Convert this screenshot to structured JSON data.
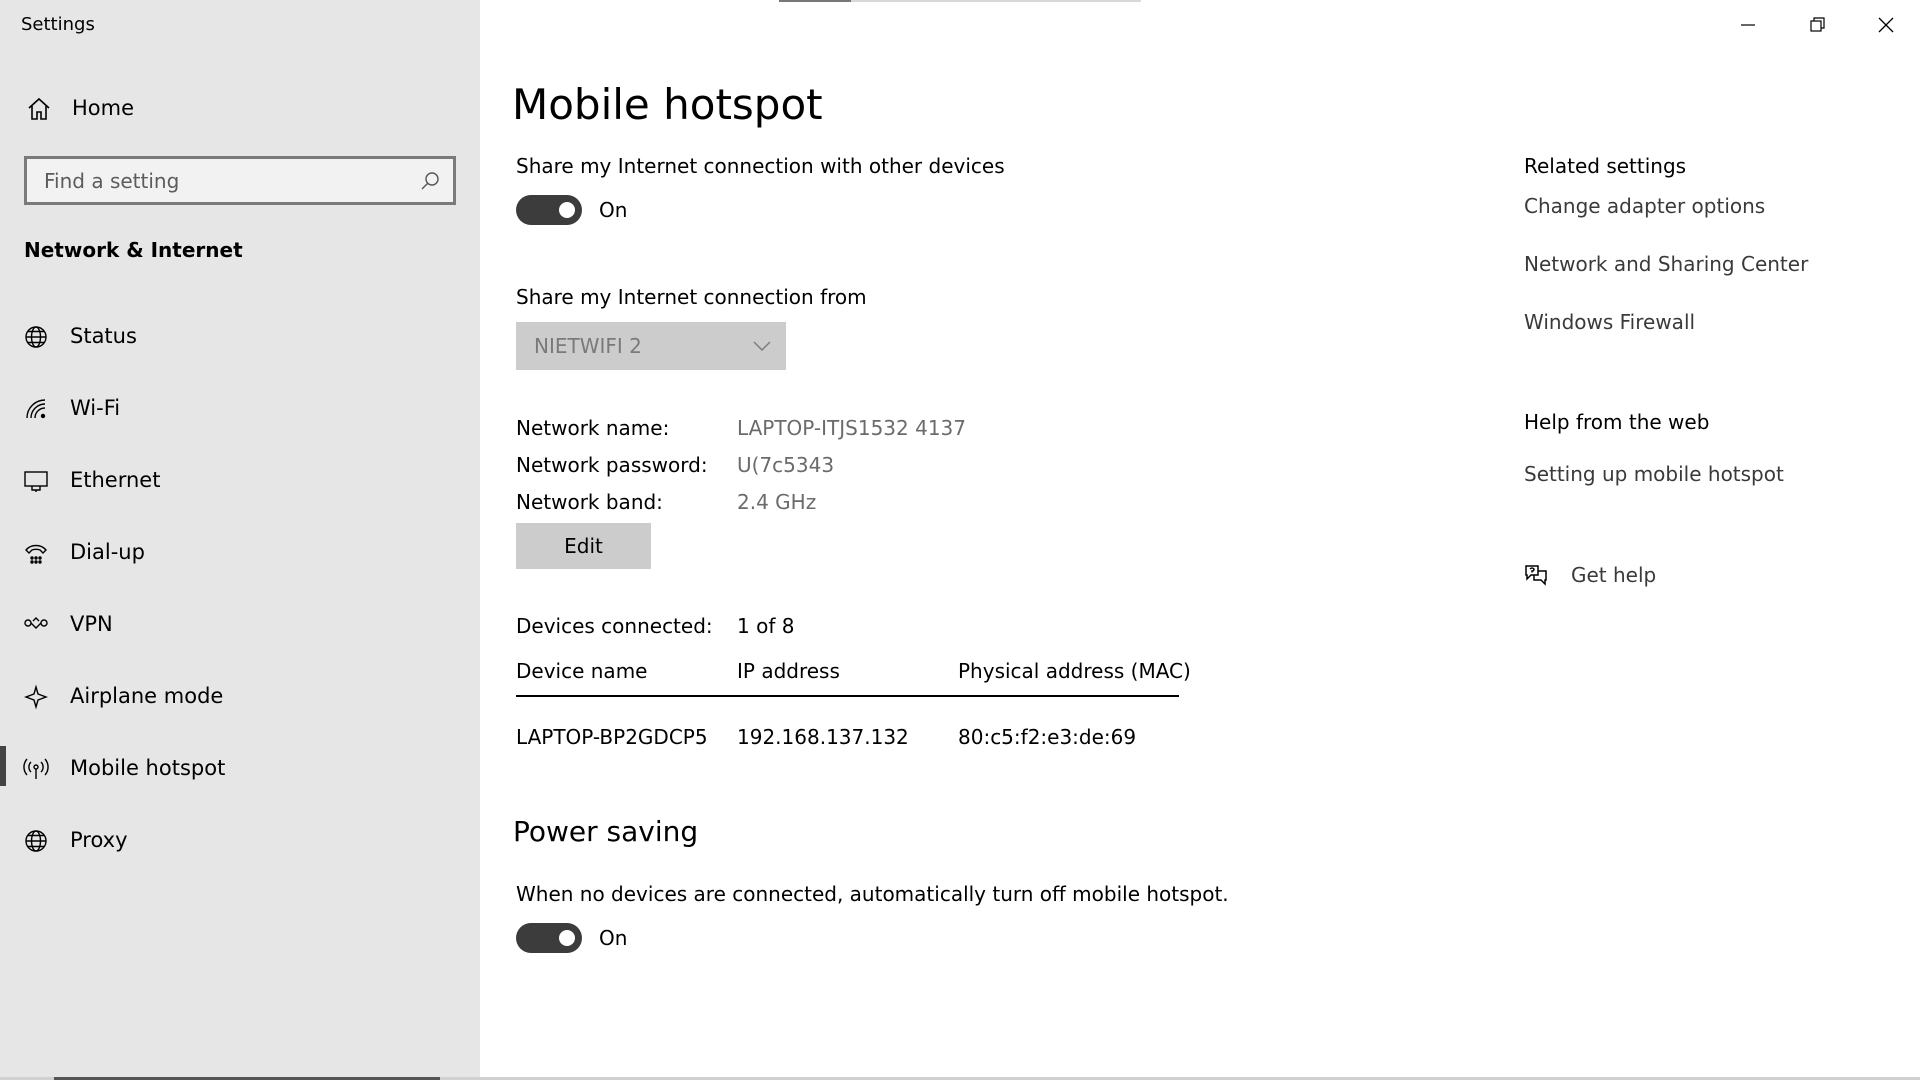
{
  "window": {
    "title": "Settings"
  },
  "sidebar": {
    "home_label": "Home",
    "search_placeholder": "Find a setting",
    "section_title": "Network & Internet",
    "items": [
      {
        "label": "Status",
        "icon": "globe-status-icon"
      },
      {
        "label": "Wi-Fi",
        "icon": "wifi-icon"
      },
      {
        "label": "Ethernet",
        "icon": "ethernet-icon"
      },
      {
        "label": "Dial-up",
        "icon": "dial-up-icon"
      },
      {
        "label": "VPN",
        "icon": "vpn-icon"
      },
      {
        "label": "Airplane mode",
        "icon": "airplane-icon"
      },
      {
        "label": "Mobile hotspot",
        "icon": "hotspot-icon",
        "selected": true
      },
      {
        "label": "Proxy",
        "icon": "globe-icon"
      }
    ]
  },
  "main": {
    "title": "Mobile hotspot",
    "share_label": "Share my Internet connection with other devices",
    "share_toggle_state": "On",
    "share_from_label": "Share my Internet connection from",
    "share_from_value": "NIETWIFI 2",
    "network": {
      "name_label": "Network name:",
      "name_value": "LAPTOP-ITJS1532 4137",
      "password_label": "Network password:",
      "password_value": "U(7c5343",
      "band_label": "Network band:",
      "band_value": "2.4 GHz"
    },
    "edit_label": "Edit",
    "devices_connected_label": "Devices connected:",
    "devices_connected_value": "1 of 8",
    "columns": [
      "Device name",
      "IP address",
      "Physical address (MAC)"
    ],
    "rows": [
      [
        "LAPTOP-BP2GDCP5",
        "192.168.137.132",
        "80:c5:f2:e3:de:69"
      ]
    ],
    "power_saving_title": "Power saving",
    "power_saving_label": "When no devices are connected, automatically turn off mobile hotspot.",
    "power_saving_toggle_state": "On"
  },
  "right": {
    "related_heading": "Related settings",
    "related_links": [
      "Change adapter options",
      "Network and Sharing Center",
      "Windows Firewall"
    ],
    "help_heading": "Help from the web",
    "help_links": [
      "Setting up mobile hotspot"
    ],
    "get_help_label": "Get help"
  },
  "colors": {
    "sidebar_bg": "#e6e6e6",
    "toggle_on": "#3c3c3c",
    "button_bg": "#cccccc"
  }
}
